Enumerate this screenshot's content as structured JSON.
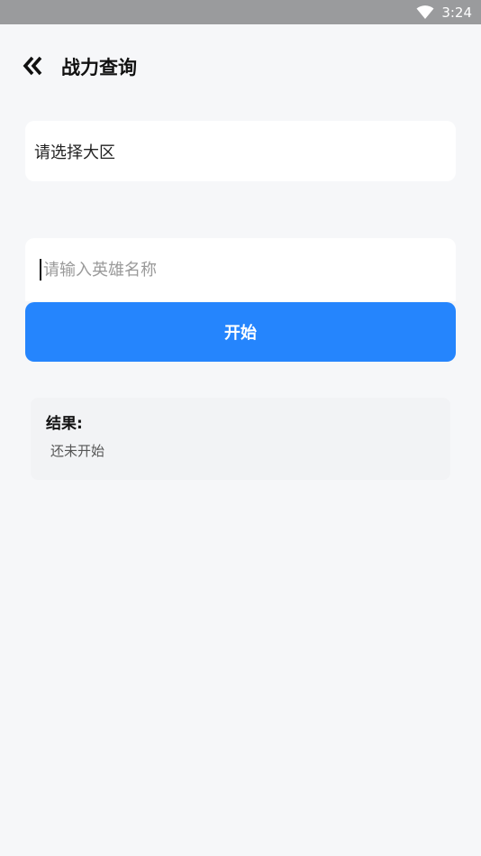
{
  "status_bar": {
    "time": "3:24",
    "wifi_icon": "wifi-icon"
  },
  "header": {
    "title": "战力查询",
    "back_icon": "chevron-double-left-icon"
  },
  "region": {
    "label": "请选择大区"
  },
  "hero": {
    "placeholder": "请输入英雄名称",
    "value": ""
  },
  "start_button": {
    "label": "开始",
    "color": "#2585fd"
  },
  "result": {
    "label": "结果:",
    "value": "还未开始"
  }
}
